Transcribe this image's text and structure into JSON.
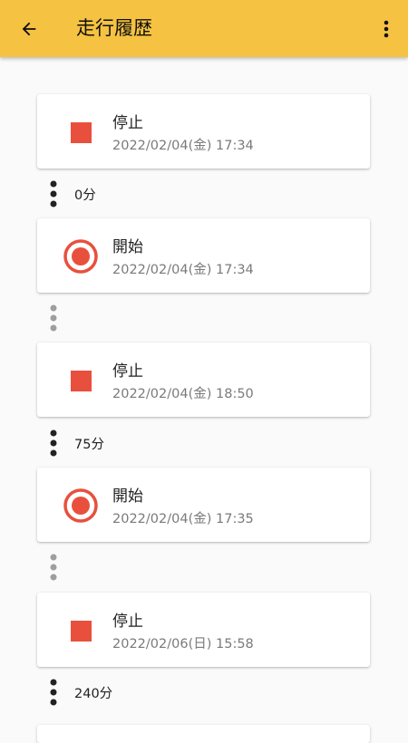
{
  "appbar": {
    "title": "走行履歴",
    "background": "#f5c242"
  },
  "icons": {
    "back": "arrow-back-icon",
    "menu": "more-vert-icon",
    "stop": "stop-square-icon",
    "start": "record-circle-icon"
  },
  "colors": {
    "accent_red": "#e8503d",
    "muted_dot": "#9e9e9e",
    "dark_dot": "#222222"
  },
  "history": {
    "events": [
      {
        "type": "stop",
        "label": "停止",
        "time": "2022/02/04(金) 17:34"
      },
      {
        "type": "start",
        "label": "開始",
        "time": "2022/02/04(金) 17:34"
      },
      {
        "type": "stop",
        "label": "停止",
        "time": "2022/02/04(金) 18:50"
      },
      {
        "type": "start",
        "label": "開始",
        "time": "2022/02/04(金) 17:35"
      },
      {
        "type": "stop",
        "label": "停止",
        "time": "2022/02/06(日) 15:58"
      }
    ],
    "durations": [
      "0分",
      "",
      "75分",
      "",
      "240分"
    ]
  }
}
